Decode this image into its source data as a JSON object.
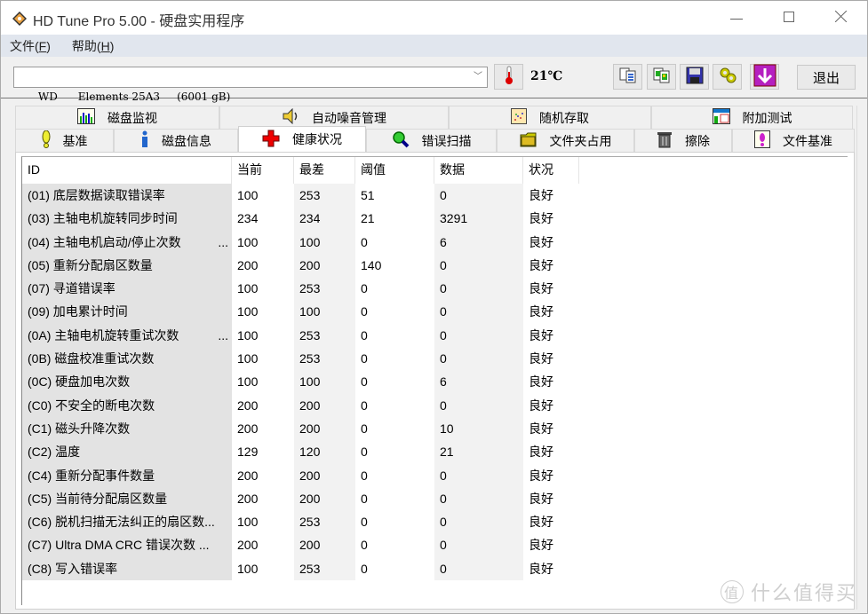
{
  "window": {
    "title": "HD Tune Pro 5.00 - 硬盘实用程序",
    "minimize_glyph": "—",
    "maximize_glyph": "☐",
    "close_glyph": "✕"
  },
  "menu": [
    {
      "label": "文件(",
      "key": "F",
      "end": ")"
    },
    {
      "label": "帮助(",
      "key": "H",
      "end": ")"
    }
  ],
  "toolbar": {
    "drive": "WD      Elements 25A3     (6001 gB)",
    "temperature": "21℃",
    "exit_label": "退出",
    "buttons": [
      "copy-text-icon",
      "copy-screenshot-icon",
      "save-icon",
      "options-icon",
      "minimize-to-tray-icon"
    ]
  },
  "tabs": {
    "top_row": [
      {
        "label": "磁盘监视",
        "icon": "disk-monitor-icon"
      },
      {
        "label": "自动噪音管理",
        "icon": "speaker-icon"
      },
      {
        "label": "随机存取",
        "icon": "random-access-icon"
      },
      {
        "label": "附加测试",
        "icon": "extra-tests-icon"
      }
    ],
    "bottom_row": [
      {
        "label": "基准",
        "icon": "benchmark-icon"
      },
      {
        "label": "磁盘信息",
        "icon": "info-icon"
      },
      {
        "label": "健康状况",
        "icon": "health-cross-icon",
        "active": true
      },
      {
        "label": "错误扫描",
        "icon": "magnifier-icon"
      },
      {
        "label": "文件夹占用",
        "icon": "folder-icon"
      },
      {
        "label": "擦除",
        "icon": "trash-icon"
      },
      {
        "label": "文件基准",
        "icon": "file-benchmark-icon"
      }
    ]
  },
  "health": {
    "columns": [
      "ID",
      "当前",
      "最差",
      "阈值",
      "数据",
      "状况"
    ],
    "rows": [
      {
        "id": "(01) 底层数据读取错误率",
        "truncated": false,
        "current": "100",
        "worst": "253",
        "threshold": "51",
        "data": "0",
        "status": "良好"
      },
      {
        "id": "(03) 主轴电机旋转同步时间",
        "truncated": false,
        "current": "234",
        "worst": "234",
        "threshold": "21",
        "data": "3291",
        "status": "良好"
      },
      {
        "id": "(04) 主轴电机启动/停止次数",
        "truncated": true,
        "current": "100",
        "worst": "100",
        "threshold": "0",
        "data": "6",
        "status": "良好"
      },
      {
        "id": "(05) 重新分配扇区数量",
        "truncated": false,
        "current": "200",
        "worst": "200",
        "threshold": "140",
        "data": "0",
        "status": "良好"
      },
      {
        "id": "(07) 寻道错误率",
        "truncated": false,
        "current": "100",
        "worst": "253",
        "threshold": "0",
        "data": "0",
        "status": "良好"
      },
      {
        "id": "(09) 加电累计时间",
        "truncated": false,
        "current": "100",
        "worst": "100",
        "threshold": "0",
        "data": "0",
        "status": "良好"
      },
      {
        "id": "(0A) 主轴电机旋转重试次数",
        "truncated": true,
        "current": "100",
        "worst": "253",
        "threshold": "0",
        "data": "0",
        "status": "良好"
      },
      {
        "id": "(0B) 磁盘校准重试次数",
        "truncated": false,
        "current": "100",
        "worst": "253",
        "threshold": "0",
        "data": "0",
        "status": "良好"
      },
      {
        "id": "(0C) 硬盘加电次数",
        "truncated": false,
        "current": "100",
        "worst": "100",
        "threshold": "0",
        "data": "6",
        "status": "良好"
      },
      {
        "id": "(C0) 不安全的断电次数",
        "truncated": false,
        "current": "200",
        "worst": "200",
        "threshold": "0",
        "data": "0",
        "status": "良好"
      },
      {
        "id": "(C1) 磁头升降次数",
        "truncated": false,
        "current": "200",
        "worst": "200",
        "threshold": "0",
        "data": "10",
        "status": "良好"
      },
      {
        "id": "(C2) 温度",
        "truncated": false,
        "current": "129",
        "worst": "120",
        "threshold": "0",
        "data": "21",
        "status": "良好"
      },
      {
        "id": "(C4) 重新分配事件数量",
        "truncated": false,
        "current": "200",
        "worst": "200",
        "threshold": "0",
        "data": "0",
        "status": "良好"
      },
      {
        "id": "(C5) 当前待分配扇区数量",
        "truncated": false,
        "current": "200",
        "worst": "200",
        "threshold": "0",
        "data": "0",
        "status": "良好"
      },
      {
        "id": "(C6) 脱机扫描无法纠正的扇区数...",
        "truncated": false,
        "current": "100",
        "worst": "253",
        "threshold": "0",
        "data": "0",
        "status": "良好"
      },
      {
        "id": "(C7) Ultra DMA CRC 错误次数 ...",
        "truncated": false,
        "current": "200",
        "worst": "200",
        "threshold": "0",
        "data": "0",
        "status": "良好"
      },
      {
        "id": "(C8) 写入错误率",
        "truncated": false,
        "current": "100",
        "worst": "253",
        "threshold": "0",
        "data": "0",
        "status": "良好"
      }
    ]
  },
  "watermark": {
    "badge": "值",
    "text": "什么值得买"
  }
}
